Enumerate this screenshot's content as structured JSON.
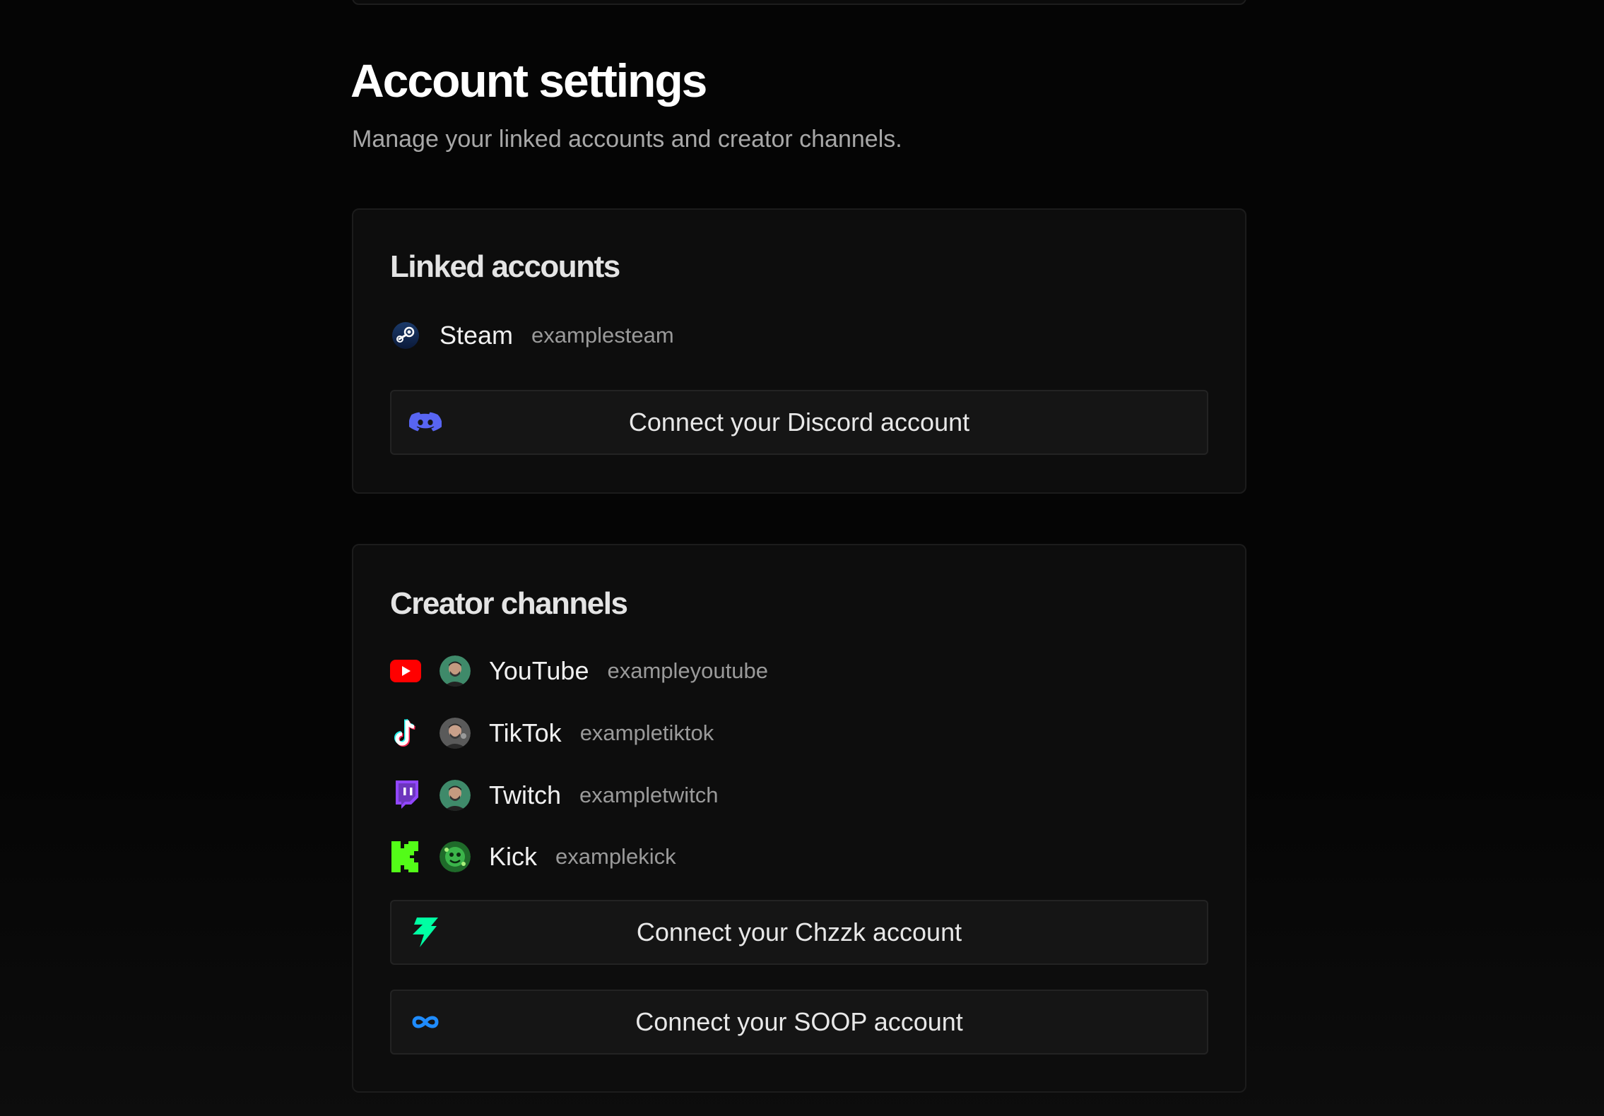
{
  "page": {
    "title": "Account settings",
    "subtitle": "Manage your linked accounts and creator channels."
  },
  "linked_accounts": {
    "title": "Linked accounts",
    "items": [
      {
        "platform": "Steam",
        "handle": "examplesteam",
        "icon": "steam-icon"
      }
    ],
    "connect_buttons": [
      {
        "label": "Connect your Discord account",
        "icon": "discord-icon",
        "color": "#5865F2"
      }
    ]
  },
  "creator_channels": {
    "title": "Creator channels",
    "items": [
      {
        "platform": "YouTube",
        "handle": "exampleyoutube",
        "icon": "youtube-icon",
        "color": "#FF0000"
      },
      {
        "platform": "TikTok",
        "handle": "exampletiktok",
        "icon": "tiktok-icon"
      },
      {
        "platform": "Twitch",
        "handle": "exampletwitch",
        "icon": "twitch-icon",
        "color": "#9146FF"
      },
      {
        "platform": "Kick",
        "handle": "examplekick",
        "icon": "kick-icon",
        "color": "#53FC18"
      }
    ],
    "connect_buttons": [
      {
        "label": "Connect your Chzzk account",
        "icon": "chzzk-icon",
        "color": "#00FFA3"
      },
      {
        "label": "Connect your SOOP account",
        "icon": "soop-icon",
        "color": "#1F8CFF"
      }
    ]
  }
}
